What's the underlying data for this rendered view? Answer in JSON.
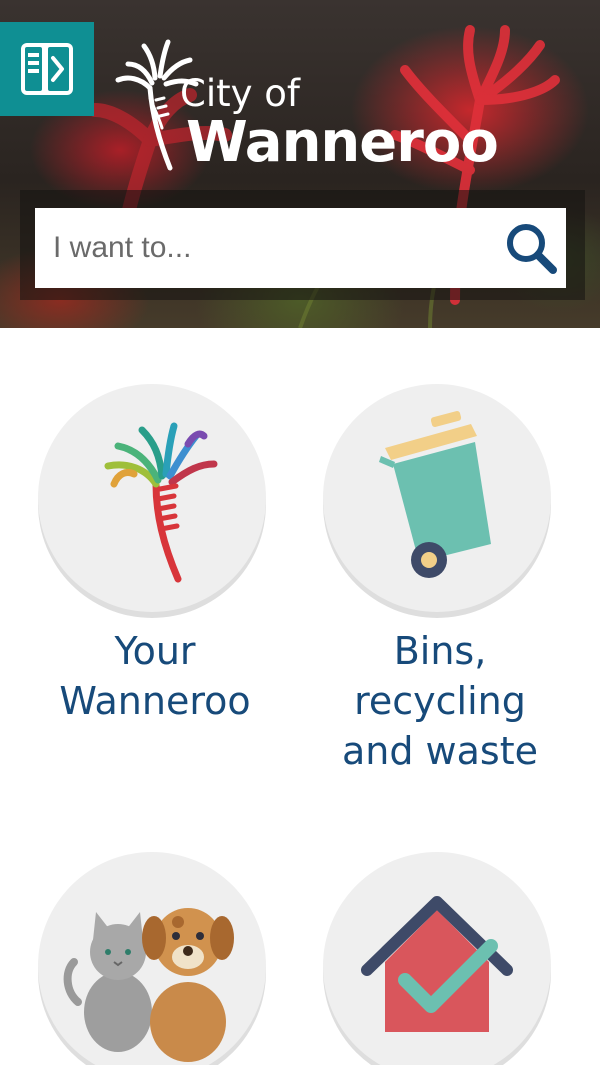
{
  "header": {
    "logo_prefix": "City of",
    "logo_name": "Wanneroo",
    "menu_icon": "sidebar-toggle-icon"
  },
  "search": {
    "placeholder": "I want to...",
    "icon": "search-icon"
  },
  "tiles": [
    {
      "label_line1": "Your",
      "label_line2": "Wanneroo",
      "label_line3": "",
      "icon": "kangaroo-paw-icon"
    },
    {
      "label_line1": "Bins,",
      "label_line2": "recycling",
      "label_line3": "and waste",
      "icon": "wheelie-bin-icon"
    },
    {
      "label_line1": "",
      "label_line2": "",
      "label_line3": "",
      "icon": "cat-and-dog-icon"
    },
    {
      "label_line1": "",
      "label_line2": "",
      "label_line3": "",
      "icon": "house-check-icon"
    }
  ],
  "colors": {
    "menu_bg": "#0f8f93",
    "label_text": "#174a7a",
    "search_icon": "#174a7a",
    "circle_bg": "#efefef"
  }
}
